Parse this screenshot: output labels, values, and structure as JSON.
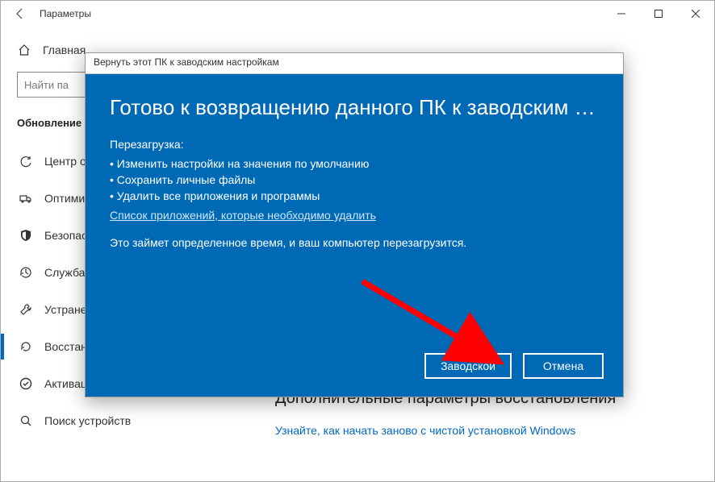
{
  "window": {
    "title": "Параметры"
  },
  "sidebar": {
    "home": "Главная",
    "search_placeholder": "Найти па",
    "section": "Обновление",
    "items": [
      {
        "label": "Центр о"
      },
      {
        "label": "Оптими"
      },
      {
        "label": "Безопас"
      },
      {
        "label": "Служба"
      },
      {
        "label": "Устране"
      },
      {
        "label": "Восстан"
      },
      {
        "label": "Активация"
      },
      {
        "label": "Поиск устройств"
      }
    ]
  },
  "dialog": {
    "titlebar": "Вернуть этот ПК к заводским настройкам",
    "heading": "Готово к возвращению данного ПК к заводским настройк...",
    "sub": "Перезагрузка:",
    "bullets": [
      "Изменить настройки на значения по умолчанию",
      "Сохранить личные файлы",
      "Удалить все приложения и программы"
    ],
    "link": "Список приложений, которые необходимо удалить",
    "note": "Это займет определенное время, и ваш компьютер перезагрузится.",
    "primary": "Заводской",
    "cancel": "Отмена"
  },
  "main": {
    "heading": "Дополнительные параметры восстановления",
    "link": "Узнайте, как начать заново с чистой установкой Windows"
  }
}
